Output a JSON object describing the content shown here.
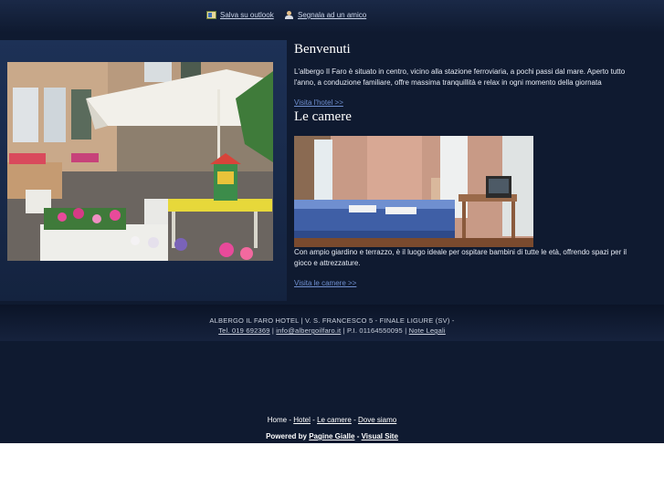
{
  "toplinks": {
    "outlook": "Salva su outlook",
    "friend": "Segnala ad un amico"
  },
  "welcome": {
    "title": "Benvenuti",
    "text": "L'albergo Il Faro è situato in centro, vicino alla stazione ferroviaria, a pochi passi dal mare. Aperto tutto l'anno, a conduzione familiare, offre massima tranquillità e relax in ogni momento della giornata",
    "link": "Visita l'hotel >>"
  },
  "rooms": {
    "title": "Le camere",
    "text": "Con ampio giardino e terrazzo, è il luogo ideale per ospitare bambini di tutte le età, offrendo spazi per il gioco e attrezzature.",
    "link": "Visita le camere >>"
  },
  "footer": {
    "address": "ALBERGO IL FARO HOTEL | V. S. FRANCESCO 5 - FINALE LIGURE (SV) -",
    "tel": "Tel. 019 692369",
    "sep1": " | ",
    "email": "info@albergoilfaro.it",
    "piva": " | P.I. 01164550095 | ",
    "legal": "Note Legali"
  },
  "nav": {
    "home": "Home",
    "sep": "-",
    "hotel": "Hotel",
    "camere": "Le camere",
    "dove": "Dove siamo"
  },
  "powered": {
    "prefix": "Powered by",
    "pagine": "Pagine Gialle",
    "dash": "-",
    "visual": "Visual Site"
  },
  "icons": [
    "outlook-icon",
    "friend-icon"
  ],
  "colors": {
    "background": "#0f1a30",
    "panel": "#1d3156",
    "link": "#6f8fcf",
    "white_strip": "#ffffff"
  }
}
